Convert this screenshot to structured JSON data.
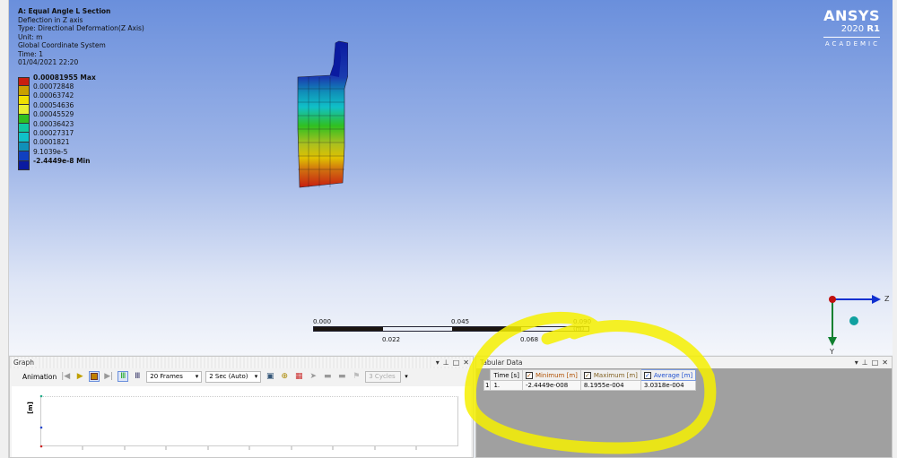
{
  "info": {
    "title": "A: Equal Angle L Section",
    "lines": [
      "Deflection in Z axis",
      "Type: Directional Deformation(Z Axis)",
      "Unit: m",
      "Global Coordinate System",
      "Time: 1",
      "01/04/2021 22:20"
    ]
  },
  "legend": [
    {
      "label": "0.00081955 Max",
      "color": "#c81e10",
      "bold": true
    },
    {
      "label": "0.00072848",
      "color": "#c8a000"
    },
    {
      "label": "0.00063742",
      "color": "#f0e000"
    },
    {
      "label": "0.00054636",
      "color": "#e8f030"
    },
    {
      "label": "0.00045529",
      "color": "#30c020"
    },
    {
      "label": "0.00036423",
      "color": "#10c8a0"
    },
    {
      "label": "0.00027317",
      "color": "#10c0c8"
    },
    {
      "label": "0.0001821",
      "color": "#1090b8"
    },
    {
      "label": "9.1039e-5",
      "color": "#1040c0"
    },
    {
      "label": "-2.4449e-8 Min",
      "color": "#0a1aa0",
      "bold": true
    }
  ],
  "logo": {
    "brand": "ANSYS",
    "version": "2020",
    "release": "R1",
    "edition": "ACADEMIC"
  },
  "scale": {
    "top": [
      "0.000",
      "0.045",
      "0.090 (m)"
    ],
    "bottom": [
      "0.022",
      "0.068"
    ]
  },
  "triad": {
    "z": "Z",
    "y": "Y"
  },
  "graph": {
    "title": "Graph",
    "animation_label": "Animation",
    "frames": "20 Frames",
    "duration": "2 Sec (Auto)",
    "cycles": "3 Cycles",
    "y_label": "[m]"
  },
  "tabular": {
    "title": "Tabular Data",
    "columns": [
      "Time [s]",
      "Minimum [m]",
      "Maximum [m]",
      "Average [m]"
    ],
    "column_colors": [
      "#111",
      "#b05000",
      "#806020",
      "#2050d0"
    ],
    "rows": [
      [
        "1",
        "1.",
        "-2.4449e-008",
        "8.1955e-004",
        "3.0318e-004"
      ]
    ]
  }
}
